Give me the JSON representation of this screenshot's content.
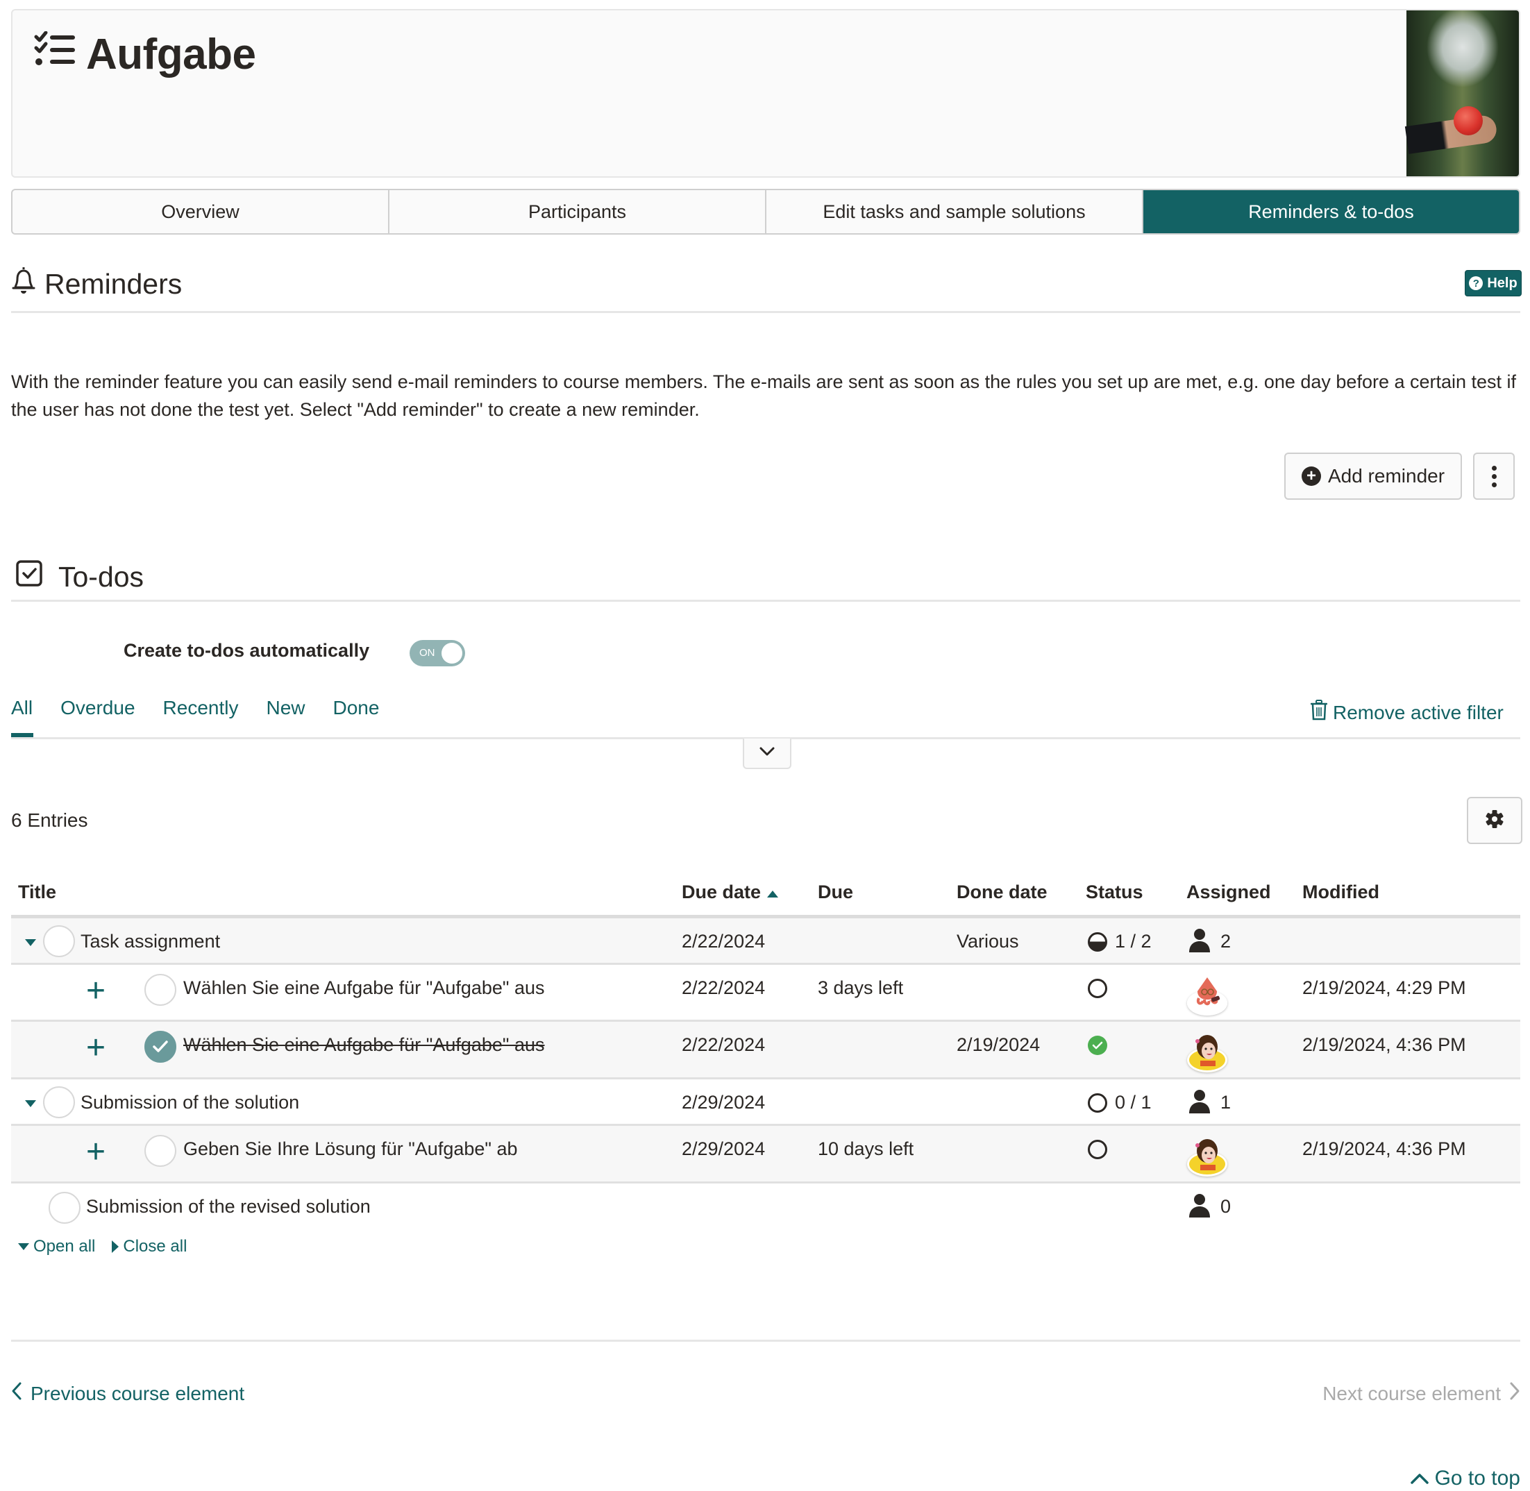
{
  "header": {
    "title": "Aufgabe",
    "title_icon": "task-list-icon",
    "image_alt": "hand holding apple in orchard"
  },
  "tabs": [
    {
      "label": "Overview",
      "active": false
    },
    {
      "label": "Participants",
      "active": false
    },
    {
      "label": "Edit tasks and sample solutions",
      "active": false
    },
    {
      "label": "Reminders & to-dos",
      "active": true
    }
  ],
  "reminders": {
    "title": "Reminders",
    "icon": "bell-icon",
    "help_label": "Help",
    "description": "With the reminder feature you can easily send e-mail reminders to course members. The e-mails are sent as soon as the rules you set up are met, e.g. one day before a certain test if the user has not done the test yet. Select \"Add reminder\" to create a new reminder.",
    "add_button_label": "Add reminder"
  },
  "todos": {
    "title": "To-dos",
    "icon": "checkbox-icon",
    "auto_create_label": "Create to-dos automatically",
    "auto_create_toggle": "ON",
    "filters": [
      {
        "label": "All",
        "active": true
      },
      {
        "label": "Overdue",
        "active": false
      },
      {
        "label": "Recently",
        "active": false
      },
      {
        "label": "New",
        "active": false
      },
      {
        "label": "Done",
        "active": false
      }
    ],
    "remove_filter_label": "Remove active filter",
    "entries_label": "6 Entries",
    "columns": [
      "Title",
      "Due date",
      "Due",
      "Done date",
      "Status",
      "Assigned",
      "Modified"
    ],
    "sort_column": "Due date",
    "sort_direction": "ascending",
    "rows": [
      {
        "type": "group",
        "expanded": true,
        "title": "Task assignment",
        "due_date": "2/22/2024",
        "due": "",
        "done_date": "Various",
        "status": "partial",
        "status_text": "1 / 2",
        "assigned_count": "2",
        "modified": ""
      },
      {
        "type": "child",
        "title": "Wählen Sie eine Aufgabe für \"Aufgabe\" aus",
        "done": false,
        "due_date": "2/22/2024",
        "due": "3 days left",
        "done_date": "",
        "status": "open",
        "assignee": "squid-avatar",
        "modified": "2/19/2024, 4:29 PM"
      },
      {
        "type": "child",
        "title": "Wählen Sie eine Aufgabe für \"Aufgabe\" aus",
        "done": true,
        "due_date": "2/22/2024",
        "due": "",
        "done_date": "2/19/2024",
        "status": "done",
        "assignee": "girl-avatar",
        "modified": "2/19/2024, 4:36 PM"
      },
      {
        "type": "group",
        "expanded": true,
        "title": "Submission of the solution",
        "due_date": "2/29/2024",
        "due": "",
        "done_date": "",
        "status": "open",
        "status_text": "0 / 1",
        "assigned_count": "1",
        "modified": ""
      },
      {
        "type": "child",
        "title": "Geben Sie Ihre Lösung für \"Aufgabe\" ab",
        "done": false,
        "due_date": "2/29/2024",
        "due": "10 days left",
        "done_date": "",
        "status": "open",
        "assignee": "girl-avatar",
        "modified": "2/19/2024, 4:36 PM"
      },
      {
        "type": "group",
        "expanded": false,
        "title": "Submission of the revised solution",
        "due_date": "",
        "due": "",
        "done_date": "",
        "status": "",
        "status_text": "",
        "assigned_count": "0",
        "modified": ""
      }
    ],
    "open_all_label": "Open all",
    "close_all_label": "Close all"
  },
  "footer": {
    "previous_label": "Previous course element",
    "next_label": "Next course element",
    "go_to_top_label": "Go to top"
  },
  "colors": {
    "accent": "#136264",
    "toggle_on": "#92b4b4",
    "done_green": "#4caf50",
    "disabled_text": "#a9a9a9"
  }
}
